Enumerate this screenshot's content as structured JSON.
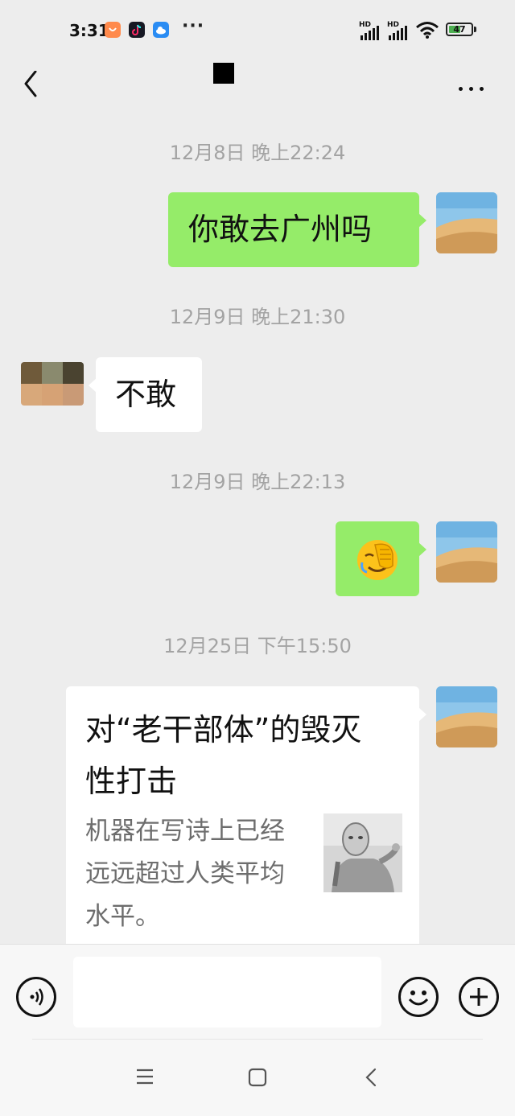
{
  "status_bar": {
    "time": "3:31",
    "more_dots": "···",
    "signal_label": "HD",
    "battery": "47"
  },
  "chat": {
    "back_icon": "chevron-left-icon",
    "more_icon": "more-horizontal-icon"
  },
  "messages": [
    {
      "timestamp": "12月8日 晚上22:24",
      "sender": "me",
      "text": "你敢去广州吗"
    },
    {
      "timestamp": "12月9日 晚上21:30",
      "sender": "other",
      "text": "不敢"
    },
    {
      "timestamp": "12月9日 晚上22:13",
      "sender": "me",
      "emoji": "🤦"
    },
    {
      "timestamp": "12月25日 下午15:50",
      "sender": "me",
      "card": {
        "title": "对“老干部体”的毁灭性打击",
        "description": "机器在写诗上已经远远超过人类平均水平。"
      }
    }
  ],
  "input_bar": {
    "voice_icon": "voice-icon",
    "emoji_icon": "emoji-icon",
    "add_icon": "plus-icon"
  },
  "system_nav": {
    "menu_icon": "menu-icon",
    "home_icon": "home-icon",
    "back_icon": "back-icon"
  },
  "colors": {
    "background": "#ededed",
    "my_bubble": "#95ec69",
    "other_bubble": "#ffffff",
    "timestamp": "#a3a3a3"
  }
}
